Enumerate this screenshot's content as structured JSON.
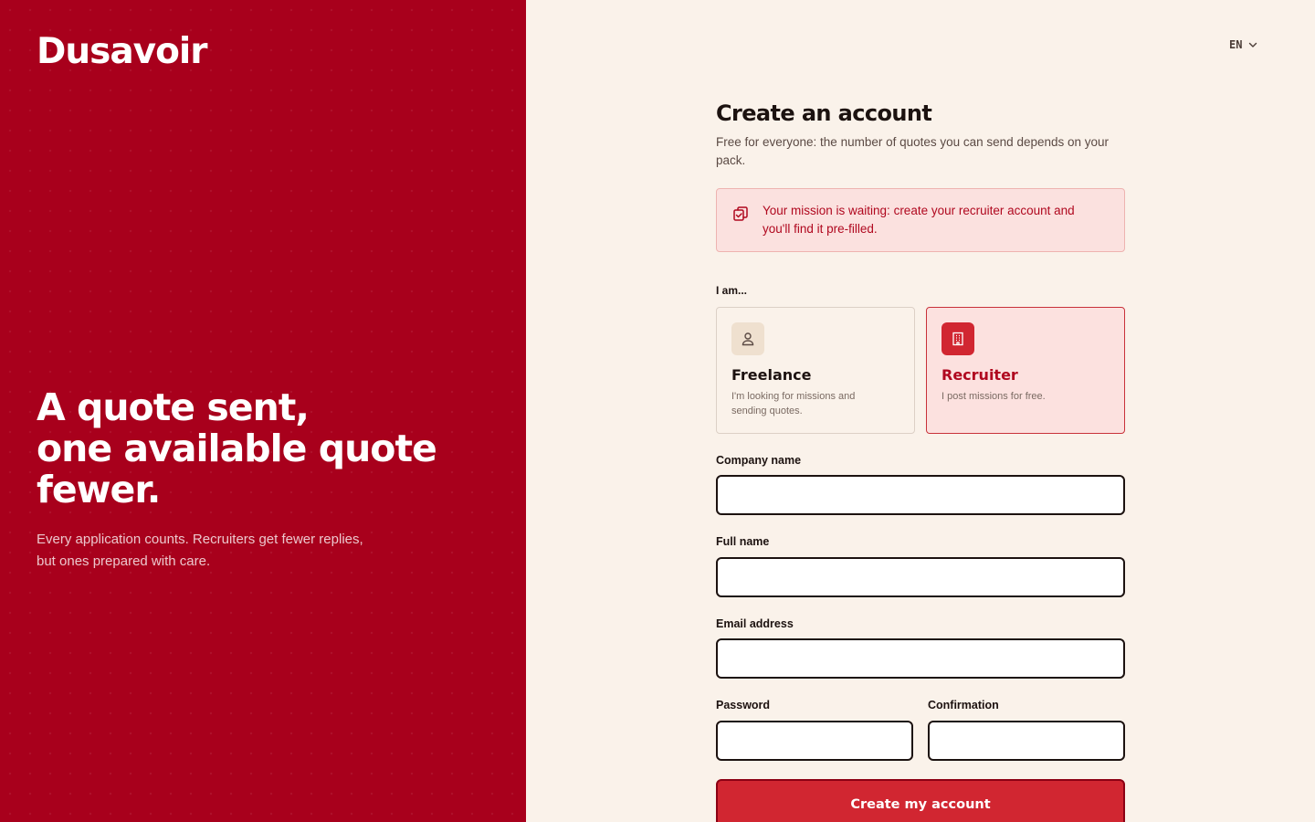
{
  "brand": {
    "logo_text": "Dusavoir",
    "headline_lines": [
      "A quote sent,",
      "one available quote",
      "fewer."
    ],
    "tagline": "Every application counts. Recruiters get fewer replies, but ones prepared with care.",
    "panel_color": "#a8001c"
  },
  "language": {
    "current": "EN",
    "icon": "chevron-down-icon"
  },
  "form": {
    "title": "Create an account",
    "subtitle": "Free for everyone: the number of quotes you can send depends on your pack.",
    "notice": {
      "icon": "copy-check-icon",
      "text": "Your mission is waiting: create your recruiter account and you'll find it pre-filled."
    },
    "role_label": "I am...",
    "roles": [
      {
        "icon": "user-icon",
        "title": "Freelance",
        "description": "I'm looking for missions and sending quotes.",
        "selected": false
      },
      {
        "icon": "building-icon",
        "title": "Recruiter",
        "description": "I post missions for free.",
        "selected": true
      }
    ],
    "fields": {
      "company": {
        "label": "Company name",
        "value": "",
        "placeholder": ""
      },
      "full_name": {
        "label": "Full name",
        "value": "",
        "placeholder": ""
      },
      "email": {
        "label": "Email address",
        "value": "",
        "placeholder": ""
      },
      "password": {
        "label": "Password",
        "value": "",
        "placeholder": ""
      },
      "confirmation": {
        "label": "Confirmation",
        "value": "",
        "placeholder": ""
      }
    },
    "submit_label": "Create my account",
    "accent_color": "#d12631"
  }
}
